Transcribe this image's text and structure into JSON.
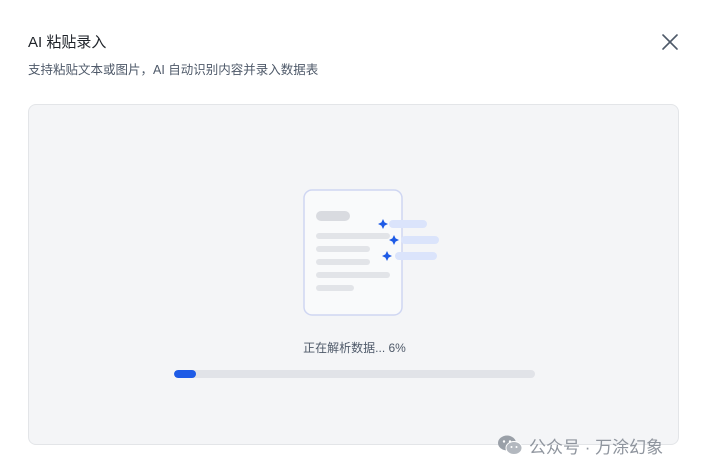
{
  "dialog": {
    "title": "AI 粘贴录入",
    "subtitle": "支持粘贴文本或图片，AI 自动识别内容并录入数据表",
    "close_icon": "close-icon"
  },
  "upload": {
    "illustration_icon": "ai-document-sparkle-icon",
    "status_text": "正在解析数据... 6%",
    "progress": 0.06
  },
  "watermark": {
    "icon": "wechat-icon",
    "text": "公众号 · 万涂幻象"
  },
  "colors": {
    "accent": "#1e5be6",
    "dropzone_bg": "#f4f5f7",
    "track": "#e1e3e8"
  }
}
